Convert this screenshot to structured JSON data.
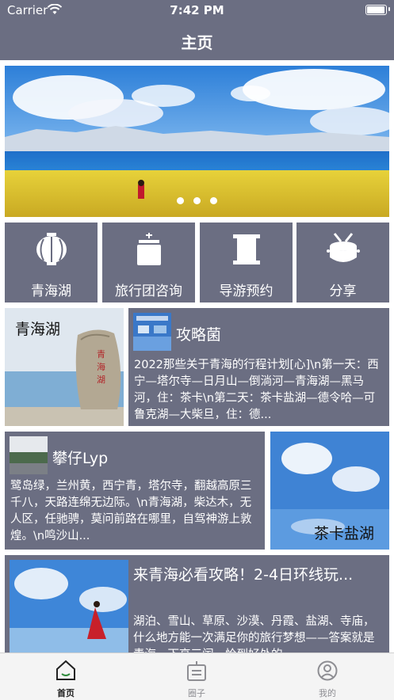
{
  "status_bar": {
    "carrier": "Carrier",
    "time": "7:42 PM"
  },
  "navbar": {
    "title": "主页"
  },
  "banner": {
    "page_count": 3,
    "current_page": 1
  },
  "tiles": [
    {
      "label": "青海湖",
      "icon": "lantern-icon"
    },
    {
      "label": "旅行团咨询",
      "icon": "jar-icon"
    },
    {
      "label": "导游预约",
      "icon": "scroll-icon"
    },
    {
      "label": "分享",
      "icon": "drum-icon"
    }
  ],
  "cards": {
    "qinghai": {
      "image_label": "青海湖"
    },
    "guide1": {
      "author": "攻略菌",
      "text": "2022那些关于青海的行程计划[心]\\n第一天：西宁—塔尔寺—日月山—倒淌河—青海湖—黑马河，住：茶卡\\n第二天：茶卡盐湖—德令哈—可鲁克湖—大柴旦，住：德..."
    },
    "guide2": {
      "author": "攀仔Lyp",
      "text": "鹭岛绿，兰州黄，西宁青，塔尔寺，翻越高原三千八，天路连绵无边际。\\n青海湖，柴达木，无人区，任驰骋，莫问前路在哪里，自驾神游上敦煌。\\n鸣沙山..."
    },
    "chaka": {
      "image_label": "茶卡盐湖"
    },
    "guide3": {
      "headline": "来青海必看攻略！2-4日环线玩...",
      "text": "湖泊、雪山、草原、沙漠、丹霞、盐湖、寺庙，什么地方能一次满足你的旅行梦想——答案就是青海。下高三闰，恰到好处的..."
    }
  },
  "tabbar": {
    "items": [
      {
        "label": "首页",
        "icon": "home-icon",
        "active": true
      },
      {
        "label": "圈子",
        "icon": "community-icon",
        "active": false
      },
      {
        "label": "我的",
        "icon": "profile-icon",
        "active": false
      }
    ]
  },
  "colors": {
    "accent": "#6b6e82",
    "tab_active": "#222222",
    "tab_inactive": "#8e8e93"
  }
}
